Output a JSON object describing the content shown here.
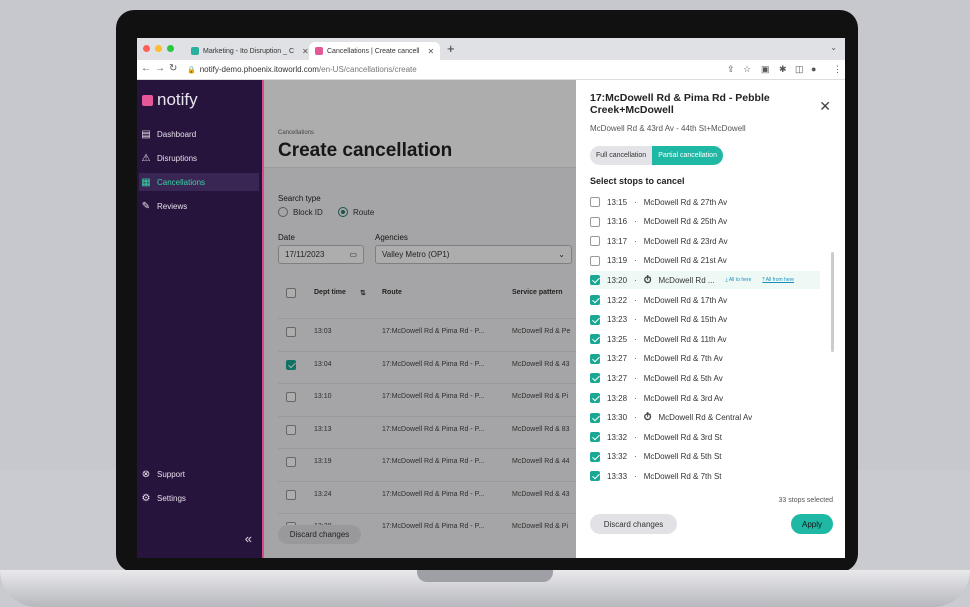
{
  "browser": {
    "tabs": [
      {
        "label": "Marketing - Ito Disruption _ C"
      },
      {
        "label": "Cancellations | Create cancell"
      }
    ],
    "url_host": "notify-demo.phoenix.itoworld.com",
    "url_path": "/en-US/cancellations/create"
  },
  "sidebar": {
    "logo": "notify",
    "items": [
      {
        "label": "Dashboard",
        "icon": "dashboard-icon"
      },
      {
        "label": "Disruptions",
        "icon": "warning-icon"
      },
      {
        "label": "Cancellations",
        "icon": "calendar-x-icon"
      },
      {
        "label": "Reviews",
        "icon": "review-icon"
      }
    ],
    "support": "Support",
    "settings": "Settings",
    "collapse": "«"
  },
  "main": {
    "breadcrumb": "Cancellations",
    "title": "Create cancellation",
    "search_type_label": "Search type",
    "radio_block": "Block ID",
    "radio_route": "Route",
    "date_label": "Date",
    "date_value": "17/11/2023",
    "agencies_label": "Agencies",
    "agencies_value": "Valley Metro (OP1)",
    "table": {
      "headers": [
        "Dept time",
        "Route",
        "Service pattern"
      ],
      "rows": [
        {
          "time": "13:03",
          "route": "17:McDowell Rd & Pima Rd - P...",
          "pattern": "McDowell Rd & Pe",
          "checked": false
        },
        {
          "time": "13:04",
          "route": "17:McDowell Rd & Pima Rd - P...",
          "pattern": "McDowell Rd & 43",
          "checked": true
        },
        {
          "time": "13:10",
          "route": "17:McDowell Rd & Pima Rd - P...",
          "pattern": "McDowell Rd & Pi",
          "checked": false
        },
        {
          "time": "13:13",
          "route": "17:McDowell Rd & Pima Rd - P...",
          "pattern": "McDowell Rd & 83",
          "checked": false
        },
        {
          "time": "13:19",
          "route": "17:McDowell Rd & Pima Rd - P...",
          "pattern": "McDowell Rd & 44",
          "checked": false
        },
        {
          "time": "13:24",
          "route": "17:McDowell Rd & Pima Rd - P...",
          "pattern": "McDowell Rd & 43",
          "checked": false
        },
        {
          "time": "13:30",
          "route": "17:McDowell Rd & Pima Rd - P...",
          "pattern": "McDowell Rd & Pi",
          "checked": false
        }
      ]
    },
    "discard": "Discard changes"
  },
  "drawer": {
    "title": "17:McDowell Rd & Pima Rd - Pebble Creek+McDowell",
    "subtitle": "McDowell Rd & 43rd Av - 44th St+McDowell",
    "seg_full": "Full cancellation",
    "seg_partial": "Partial cancellation",
    "heading": "Select stops to cancel",
    "stops": [
      {
        "time": "13:15",
        "name": "McDowell Rd & 27th Av",
        "checked": false
      },
      {
        "time": "13:16",
        "name": "McDowell Rd & 25th Av",
        "checked": false
      },
      {
        "time": "13:17",
        "name": "McDowell Rd & 23rd Av",
        "checked": false
      },
      {
        "time": "13:19",
        "name": "McDowell Rd & 21st Av",
        "checked": false
      },
      {
        "time": "13:20",
        "name": "McDowell Rd ...",
        "checked": true,
        "timer": true,
        "all_to": "All to here",
        "all_from": "All from here"
      },
      {
        "time": "13:22",
        "name": "McDowell Rd & 17th Av",
        "checked": true
      },
      {
        "time": "13:23",
        "name": "McDowell Rd & 15th Av",
        "checked": true
      },
      {
        "time": "13:25",
        "name": "McDowell Rd & 11th Av",
        "checked": true
      },
      {
        "time": "13:27",
        "name": "McDowell Rd & 7th Av",
        "checked": true
      },
      {
        "time": "13:27",
        "name": "McDowell Rd & 5th Av",
        "checked": true
      },
      {
        "time": "13:28",
        "name": "McDowell Rd & 3rd Av",
        "checked": true
      },
      {
        "time": "13:30",
        "name": "McDowell Rd & Central Av",
        "checked": true,
        "timer": true
      },
      {
        "time": "13:32",
        "name": "McDowell Rd & 3rd St",
        "checked": true
      },
      {
        "time": "13:32",
        "name": "McDowell Rd & 5th St",
        "checked": true
      },
      {
        "time": "13:33",
        "name": "McDowell Rd & 7th St",
        "checked": true
      }
    ],
    "count": "33 stops selected",
    "discard": "Discard changes",
    "apply": "Apply"
  },
  "colors": {
    "accent": "#1fb8a5",
    "sidebar_bg": "#27143d",
    "brand_pink": "#e4589a"
  }
}
